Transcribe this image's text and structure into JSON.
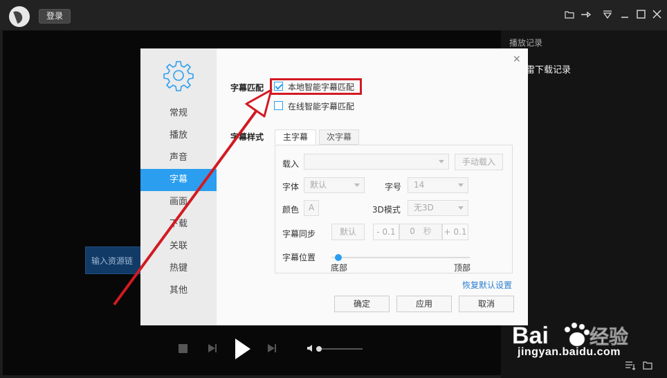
{
  "header": {
    "login_label": "登录",
    "icons": [
      "folder-icon",
      "pin-icon",
      "dropdown-menu-icon",
      "minimize-icon",
      "maximize-icon",
      "close-icon"
    ]
  },
  "side_panel": {
    "title": "播放记录",
    "item": "雷下载记录"
  },
  "url_input": {
    "placeholder": "输入资源链"
  },
  "dialog": {
    "nav_items": [
      "常规",
      "播放",
      "声音",
      "字幕",
      "画面",
      "下载",
      "关联",
      "热键",
      "其他"
    ],
    "active_index": 3,
    "match": {
      "label": "字幕匹配",
      "local": {
        "label": "本地智能字幕匹配",
        "checked": true
      },
      "online": {
        "label": "在线智能字幕匹配",
        "checked": false
      }
    },
    "style": {
      "label": "字幕样式",
      "tabs": [
        "主字幕",
        "次字幕"
      ],
      "load_label": "载入",
      "manual_load": "手动载入",
      "font_label": "字体",
      "font_value": "默认",
      "size_label": "字号",
      "size_value": "14",
      "color_label": "颜色",
      "color_glyph": "A",
      "mode3d_label": "3D模式",
      "mode3d_value": "无3D",
      "sync_label": "字幕同步",
      "sync_default": "默认",
      "sync_minus": "- 0.1",
      "sync_value": "0",
      "sync_unit": "秒",
      "sync_plus": "+ 0.1",
      "pos_label": "字幕位置",
      "pos_bottom": "底部",
      "pos_top": "顶部",
      "position_value": 0.0
    },
    "reset_link": "恢复默认设置",
    "buttons": {
      "ok": "确定",
      "apply": "应用",
      "cancel": "取消"
    }
  },
  "watermark": {
    "logo": "Baidu经验",
    "url": "jingyan.baidu.com"
  },
  "colors": {
    "accent": "#2b9ef0",
    "highlight": "#d21a22"
  }
}
